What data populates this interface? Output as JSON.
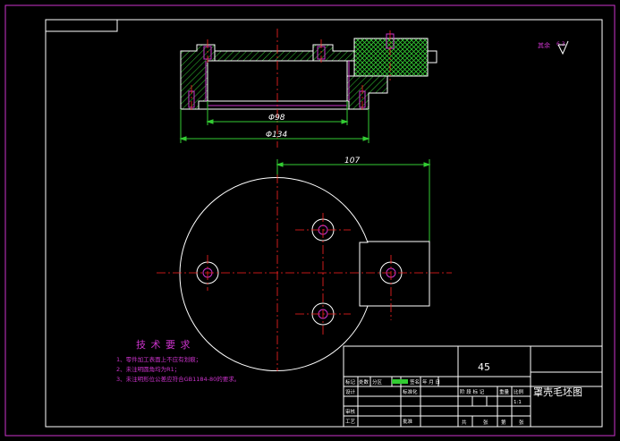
{
  "colors": {
    "background": "#000000",
    "frame": "#cc33cc",
    "outline": "#ffffff",
    "centerline": "#ff2222",
    "hatch": "#33cc33",
    "dimension": "#33cc33",
    "annotation": "#cc33cc",
    "hidden": "#cc33cc"
  },
  "roughness": {
    "label": "其余",
    "value": "6.3"
  },
  "dimensions": {
    "inner_diameter": "Φ98",
    "outer_diameter": "Φ134",
    "offset": "107"
  },
  "tech_requirements": {
    "title": "技 术 要 求",
    "items": [
      "1、零件加工表面上不应有划痕；",
      "2、未注明圆角均为R1；",
      "3、未注明形位公差应符合GB1184-80的要求。"
    ]
  },
  "title_block": {
    "material": "45",
    "drawing_title": "罩壳毛坯图",
    "rev_headers": [
      "标记",
      "处数",
      "分区",
      "更改文件号",
      "签名",
      "年 月 日"
    ],
    "roles": [
      "设计",
      "审核",
      "工艺"
    ],
    "role_mid": [
      "标准化",
      "",
      "批准"
    ],
    "stage_headers": [
      "阶 段 标 记",
      "重量",
      "比例"
    ],
    "scale": "1:1",
    "sheet_info": [
      "共",
      "张",
      "第",
      "张"
    ]
  }
}
